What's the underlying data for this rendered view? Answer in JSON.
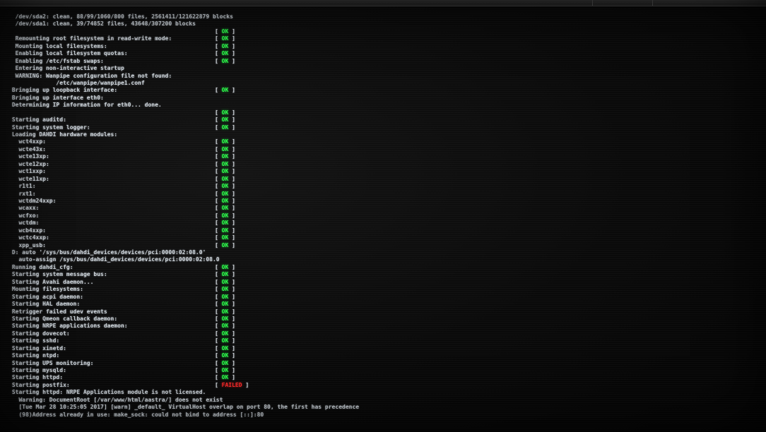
{
  "lines": [
    {
      "text": "  /dev/sda2: clean, 88/99/1060/800 files, 2561411/121622879 blocks",
      "status": ""
    },
    {
      "text": "  /dev/sda1: clean, 39/74852 files, 43648/307200 blocks",
      "status": ""
    },
    {
      "text": "",
      "status": "OK"
    },
    {
      "text": "  Remounting root filesystem in read-write mode:",
      "status": "OK"
    },
    {
      "text": "  Mounting local filesystems:",
      "status": "OK"
    },
    {
      "text": "  Enabling local filesystem quotas:",
      "status": "OK"
    },
    {
      "text": "  Enabling /etc/fstab swaps:",
      "status": "OK"
    },
    {
      "text": "  Entering non-interactive startup",
      "status": ""
    },
    {
      "text": "  WARNING: Wanpipe configuration file not found:",
      "status": ""
    },
    {
      "text": "              /etc/wanpipe/wanpipe1.conf",
      "status": ""
    },
    {
      "text": " Bringing up loopback interface:",
      "status": "OK"
    },
    {
      "text": " Bringing up interface eth0:",
      "status": ""
    },
    {
      "text": " Determining IP information for eth0... done.",
      "status": ""
    },
    {
      "text": "",
      "status": "OK"
    },
    {
      "text": " Starting auditd:",
      "status": "OK"
    },
    {
      "text": " Starting system logger:",
      "status": "OK"
    },
    {
      "text": " Loading DAHDI hardware modules:",
      "status": ""
    },
    {
      "text": "   wct4xxp:",
      "status": "OK"
    },
    {
      "text": "   wcte43x:",
      "status": "OK"
    },
    {
      "text": "   wcte13xp:",
      "status": "OK"
    },
    {
      "text": "   wcte12xp:",
      "status": "OK"
    },
    {
      "text": "   wct1xxp:",
      "status": "OK"
    },
    {
      "text": "   wcte11xp:",
      "status": "OK"
    },
    {
      "text": "   r1t1:",
      "status": "OK"
    },
    {
      "text": "   rxt1:",
      "status": "OK"
    },
    {
      "text": "   wctdm24xxp:",
      "status": "OK"
    },
    {
      "text": "   wcaxx:",
      "status": "OK"
    },
    {
      "text": "   wcfxo:",
      "status": "OK"
    },
    {
      "text": "   wctdm:",
      "status": "OK"
    },
    {
      "text": "   wcb4xxp:",
      "status": "OK"
    },
    {
      "text": "   wctc4xxp:",
      "status": "OK"
    },
    {
      "text": "   xpp_usb:",
      "status": "OK"
    },
    {
      "text": " D: auto '/sys/bus/dahdi_devices/devices/pci:0000:02:08.0'",
      "status": ""
    },
    {
      "text": "   auto-assign /sys/bus/dahdi_devices/devices/pci:0000:02:08.0",
      "status": ""
    },
    {
      "text": " Running dahdi_cfg:",
      "status": "OK"
    },
    {
      "text": " Starting system message bus:",
      "status": "OK"
    },
    {
      "text": " Starting Avahi daemon...",
      "status": "OK"
    },
    {
      "text": " Mounting filesystems:",
      "status": "OK"
    },
    {
      "text": " Starting acpi daemon:",
      "status": "OK"
    },
    {
      "text": " Starting HAL daemon:",
      "status": "OK"
    },
    {
      "text": " Retrigger failed udev events",
      "status": "OK"
    },
    {
      "text": " Starting Qmeon callback daemon:",
      "status": "OK"
    },
    {
      "text": " Starting NRPE applications daemon:",
      "status": "OK"
    },
    {
      "text": " Starting dovecot:",
      "status": "OK"
    },
    {
      "text": " Starting sshd:",
      "status": "OK"
    },
    {
      "text": " Starting xinetd:",
      "status": "OK"
    },
    {
      "text": " Starting ntpd:",
      "status": "OK"
    },
    {
      "text": " Starting UPS monitoring:",
      "status": "OK"
    },
    {
      "text": " Starting mysqld:",
      "status": "OK"
    },
    {
      "text": " Starting httpd:",
      "status": "OK"
    },
    {
      "text": " Starting postfix:",
      "status": "FAILED"
    },
    {
      "text": " Starting httpd: NRPE Applications module is not licensed.",
      "status": ""
    },
    {
      "text": "   Warning: DocumentRoot [/var/www/html/aastra/] does not exist",
      "status": ""
    },
    {
      "text": "   [Tue Mar 28 10:25:05 2017] [warn] _default_ VirtualHost overlap on port 80, the first has precedence",
      "status": ""
    },
    {
      "text": "   (98)Address already in use: make_sock: could not bind to address [::]:80",
      "status": ""
    }
  ],
  "status_labels": {
    "ok": "OK",
    "failed": "FAILED",
    "open": "[ ",
    "close": " ]"
  },
  "colors": {
    "ok": "#2cff4a",
    "failed": "#ff2a2a",
    "text": "#cfd6dc"
  }
}
